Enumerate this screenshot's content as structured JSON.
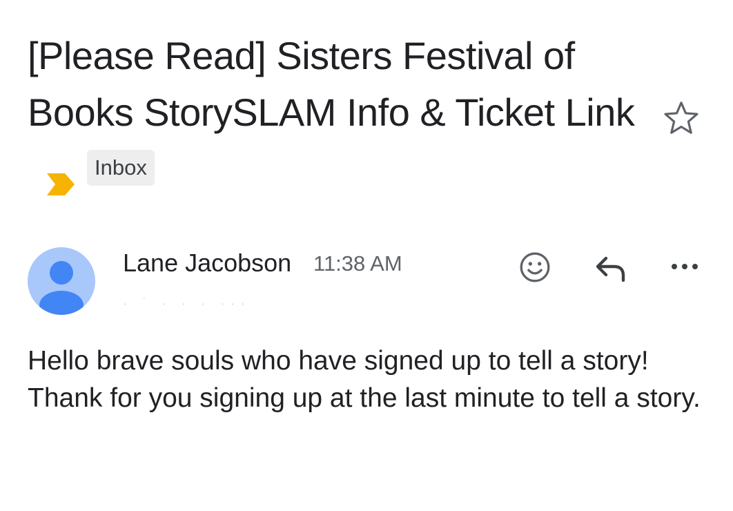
{
  "email": {
    "subject": "[Please Read] Sisters Festival of Books StorySLAM Info & Ticket Link",
    "label": "Inbox",
    "importance_color": "#f6b400",
    "star_icon": "star-outline-icon"
  },
  "sender": {
    "name": "Lane Jacobson",
    "time": "11:38 AM",
    "avatar_color": "#a8c7fa",
    "avatar_figure_color": "#4285f4"
  },
  "actions": {
    "react_icon": "smiley-icon",
    "reply_icon": "reply-arrow-icon",
    "more_icon": "more-horizontal-icon"
  },
  "body": {
    "line1": "Hello brave souls who have signed up to tell a story!",
    "line2": "Thank for you signing up at the last minute to tell a story."
  }
}
